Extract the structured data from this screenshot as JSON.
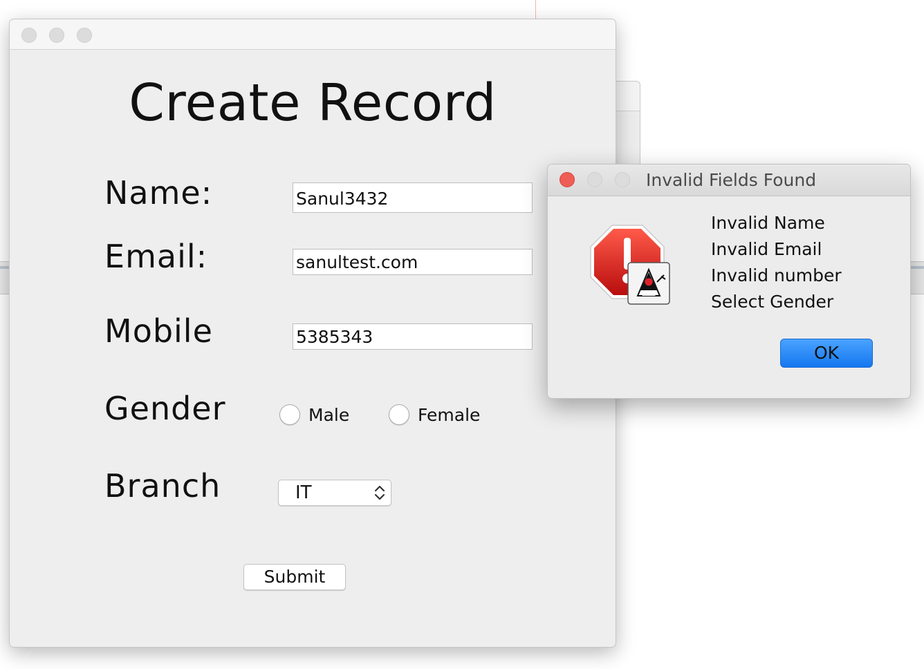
{
  "main_window": {
    "title": "Create Record",
    "form": {
      "name": {
        "label": "Name:",
        "value": "Sanul3432"
      },
      "email": {
        "label": "Email:",
        "value": "sanultest.com"
      },
      "mobile": {
        "label": "Mobile",
        "value": "5385343"
      },
      "gender": {
        "label": "Gender",
        "options": [
          "Male",
          "Female"
        ],
        "selected": null
      },
      "branch": {
        "label": "Branch",
        "selected": "IT"
      },
      "submit_label": "Submit"
    }
  },
  "dialog": {
    "title": "Invalid Fields Found",
    "messages": [
      "Invalid Name",
      "Invalid Email",
      "Invalid number",
      "Select Gender"
    ],
    "ok_label": "OK",
    "icon": "stop-warning-icon"
  },
  "colors": {
    "accent": "#1577f0",
    "close_button": "#ee5e56",
    "window_bg": "#eeeeee"
  }
}
